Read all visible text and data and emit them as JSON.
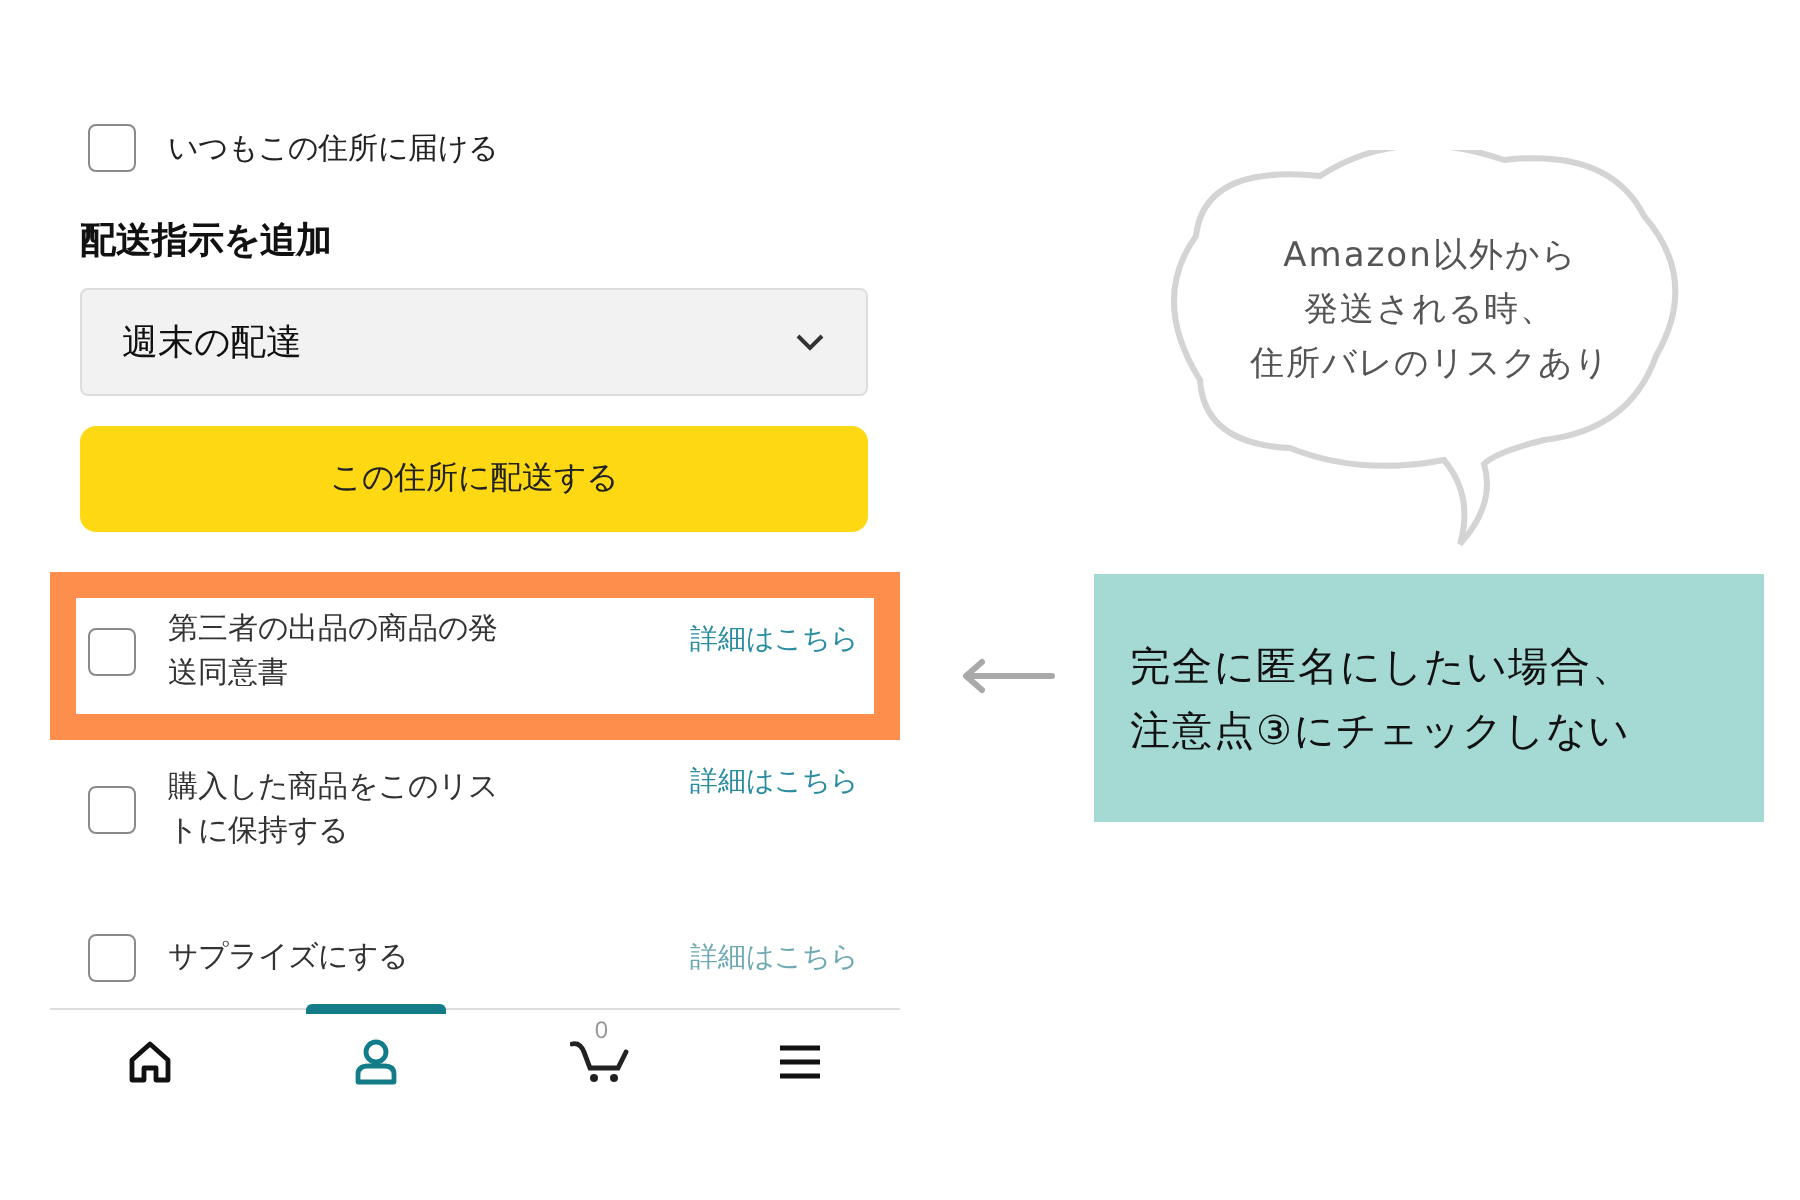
{
  "always_deliver": {
    "label": "いつもこの住所に届ける",
    "checked": false
  },
  "instructions": {
    "heading": "配送指示を追加",
    "dropdown_value": "週末の配達"
  },
  "ship_button": "この住所に配送する",
  "options": [
    {
      "label": "第三者の出品の商品の発送同意書",
      "link": "詳細はこちら",
      "checked": false,
      "highlighted": true,
      "dimmed": false
    },
    {
      "label": "購入した商品をこのリストに保持する",
      "link": "詳細はこちら",
      "checked": false,
      "highlighted": false,
      "dimmed": false
    },
    {
      "label": "サプライズにする",
      "link": "詳細はこちら",
      "checked": false,
      "highlighted": false,
      "dimmed": true
    }
  ],
  "bottom_nav": [
    {
      "kind": "home",
      "selected": false
    },
    {
      "kind": "account",
      "selected": true
    },
    {
      "kind": "cart",
      "badge": "0",
      "selected": false
    },
    {
      "kind": "menu",
      "selected": false
    }
  ],
  "callout": {
    "lines": [
      "Amazon以外から",
      "発送される時、",
      "住所バレのリスクあり"
    ]
  },
  "note": {
    "lines": [
      "完全に匿名にしたい場合、",
      "注意点③にチェックしない"
    ]
  }
}
